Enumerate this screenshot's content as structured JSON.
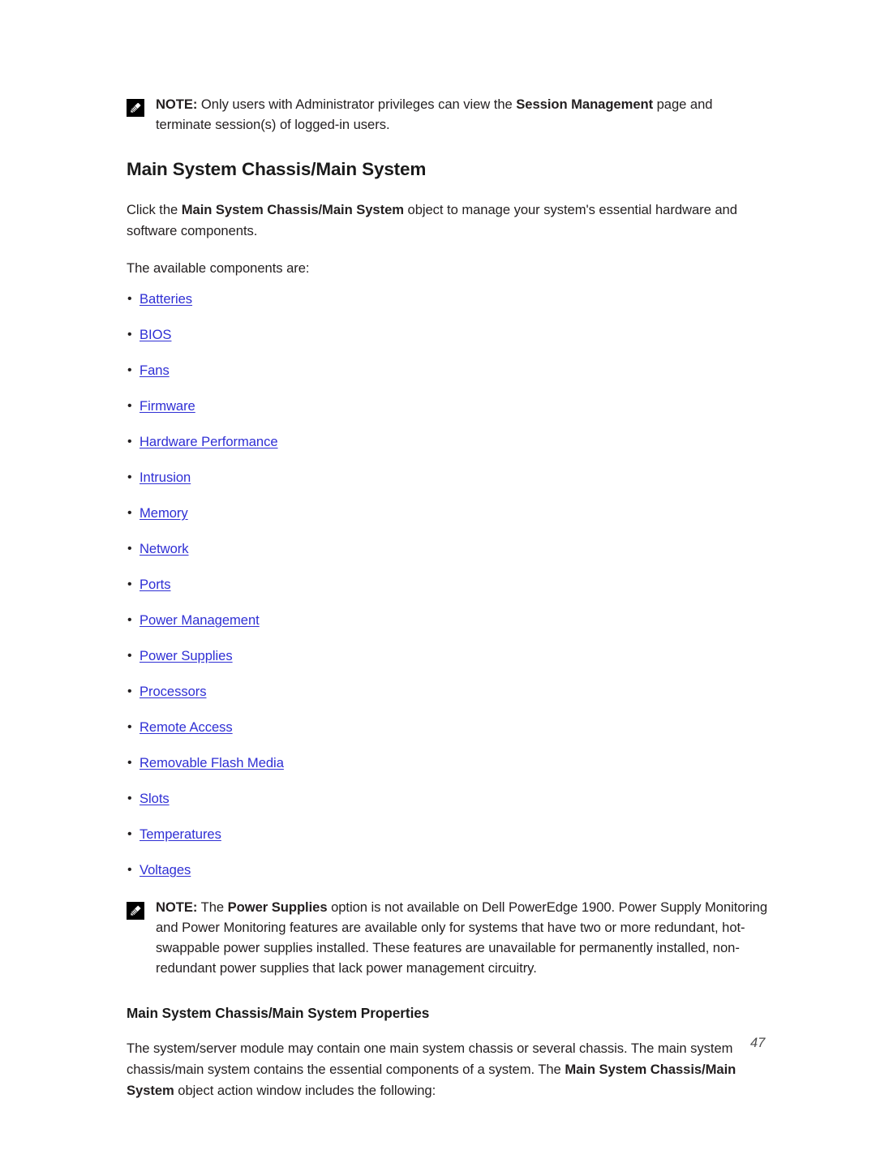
{
  "document": {
    "page_number": "47"
  },
  "note_top": {
    "icon": "note-pencil-icon",
    "label": "NOTE:",
    "text_part1": " Only users with Administrator privileges can view the ",
    "bold1": "Session Management",
    "text_part2": " page and terminate session(s) of logged-in users."
  },
  "section": {
    "title": "Main System Chassis/Main System",
    "intro_part1": "Click the ",
    "intro_bold": "Main System Chassis/Main System",
    "intro_part2": " object to manage your system's essential hardware and software components.",
    "available_label": "The available components are:"
  },
  "components": [
    {
      "label": "Batteries"
    },
    {
      "label": "BIOS"
    },
    {
      "label": "Fans"
    },
    {
      "label": "Firmware"
    },
    {
      "label": "Hardware Performance"
    },
    {
      "label": "Intrusion"
    },
    {
      "label": "Memory"
    },
    {
      "label": "Network"
    },
    {
      "label": "Ports"
    },
    {
      "label": "Power Management"
    },
    {
      "label": " Power Supplies"
    },
    {
      "label": "Processors"
    },
    {
      "label": "Remote Access"
    },
    {
      "label": "Removable Flash Media"
    },
    {
      "label": "Slots"
    },
    {
      "label": "Temperatures"
    },
    {
      "label": "Voltages"
    }
  ],
  "note_bottom": {
    "icon": "note-pencil-icon",
    "label": "NOTE:",
    "text_part1": " The ",
    "bold1": "Power Supplies",
    "text_part2": " option is not available on Dell PowerEdge 1900. Power Supply Monitoring and Power Monitoring features are available only for systems that have two or more redundant, hot-swappable power supplies installed. These features are unavailable for permanently installed, non-redundant power supplies that lack power management circuitry."
  },
  "properties": {
    "title": "Main System Chassis/Main System Properties",
    "para_part1": "The system/server module may contain one main system chassis or several chassis. The main system chassis/main system contains the essential components of a system. The ",
    "para_bold": "Main System Chassis/Main System",
    "para_part2": " object action window includes the following:"
  },
  "colors": {
    "link": "#2f2fd4",
    "body_text": "#231f20",
    "heading": "#1a1a1a",
    "page_number": "#4d4d4d",
    "background": "#ffffff"
  }
}
